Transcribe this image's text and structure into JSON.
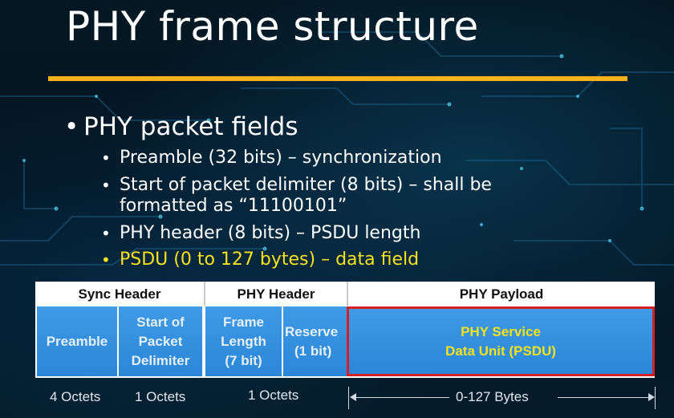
{
  "slide": {
    "title": "PHY frame structure",
    "accent_color": "#f4b21b",
    "highlight_color": "#f7e21b",
    "main_bullet": "PHY packet fields",
    "sub_bullets": [
      "Preamble (32 bits) – synchronization",
      "Start of packet delimiter (8 bits) – shall be",
      "formatted as “11100101”",
      "PHY header (8 bits) – PSDU length",
      "PSDU (0 to 127 bytes) – data field"
    ],
    "bullet_glyph": "•"
  },
  "frame": {
    "headers": {
      "sync": "Sync Header",
      "phy": "PHY Header",
      "payload": "PHY Payload"
    },
    "fields": {
      "preamble": "Preamble",
      "sfd_line1": "Start of",
      "sfd_line2": "Packet",
      "sfd_line3": "Delimiter",
      "frame_len_line1": "Frame",
      "frame_len_line2": "Length",
      "frame_len_line3": "(7 bit)",
      "reserve_line1": "Reserve",
      "reserve_line2": "(1 bit)",
      "psdu_line1": "PHY Service",
      "psdu_line2": "Data Unit (PSDU)"
    },
    "sizes": {
      "preamble": "4 Octets",
      "sfd": "1 Octets",
      "phy_header": "1 Octets",
      "payload": "0-127 Bytes"
    },
    "cell_color": "#2a86d8",
    "psdu_border_color": "#d42020"
  }
}
